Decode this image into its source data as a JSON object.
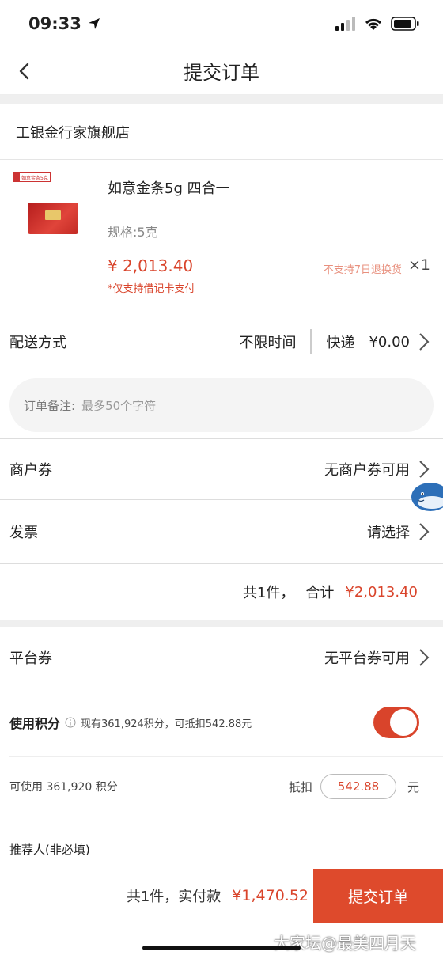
{
  "status": {
    "time": "09:33"
  },
  "nav": {
    "title": "提交订单"
  },
  "shop": {
    "name": "工银金行家旗舰店"
  },
  "product": {
    "badge": "如意金条5克",
    "title": "如意金条5g 四合一",
    "spec": "规格:5克",
    "price": "¥ 2,013.40",
    "payment_note": "*仅支持借记卡支付",
    "return_note": "不支持7日退换货",
    "quantity": "×1"
  },
  "delivery": {
    "label": "配送方式",
    "time": "不限时间",
    "method": "快递",
    "fee": "¥0.00"
  },
  "remark": {
    "label": "订单备注:",
    "placeholder": "最多50个字符"
  },
  "merchant_coupon": {
    "label": "商户券",
    "value": "无商户券可用"
  },
  "invoice": {
    "label": "发票",
    "value": "请选择"
  },
  "subtotal": {
    "count": "共1件，",
    "total_label": "合计",
    "total": "¥2,013.40"
  },
  "platform_coupon": {
    "label": "平台券",
    "value": "无平台券可用"
  },
  "points": {
    "label": "使用积分",
    "info": "现有361,924积分，可抵扣542.88元",
    "available": "可使用 361,920 积分",
    "deduct_label": "抵扣",
    "deduct_value": "542.88",
    "unit": "元",
    "enabled": true
  },
  "referrer": {
    "label": "推荐人(非必填)"
  },
  "footer": {
    "summary": "共1件，实付款",
    "amount": "¥1,470.52",
    "submit": "提交订单"
  },
  "watermark": "大家坛@最美四月天",
  "colors": {
    "accent": "#d9442b",
    "button": "#de4a2c"
  }
}
